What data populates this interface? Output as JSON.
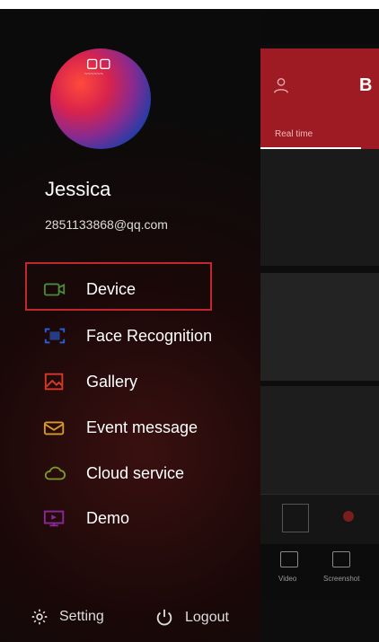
{
  "user": {
    "name": "Jessica",
    "email": "2851133868@qq.com",
    "avatar_glyph": "▢▢",
    "avatar_text": "~~~~~~"
  },
  "menu": {
    "items": [
      {
        "label": "Device",
        "icon": "camera-icon",
        "color": "#4a8a3a",
        "selected": true
      },
      {
        "label": "Face Recognition",
        "icon": "face-recognition-icon",
        "color": "#2b5fd6"
      },
      {
        "label": "Gallery",
        "icon": "gallery-icon",
        "color": "#d83a2a"
      },
      {
        "label": "Event message",
        "icon": "mail-icon",
        "color": "#d89a2a"
      },
      {
        "label": "Cloud service",
        "icon": "cloud-icon",
        "color": "#7a9a2a"
      },
      {
        "label": "Demo",
        "icon": "demo-icon",
        "color": "#8a2a9a"
      }
    ],
    "selected_border_color": "#c0282d"
  },
  "footer": {
    "setting_label": "Setting",
    "logout_label": "Logout"
  },
  "background_app": {
    "header_color": "#9e1b24",
    "title_fragment": "B",
    "tab_label": "Real time",
    "bottom_labels": [
      "Video",
      "Screenshot"
    ]
  }
}
